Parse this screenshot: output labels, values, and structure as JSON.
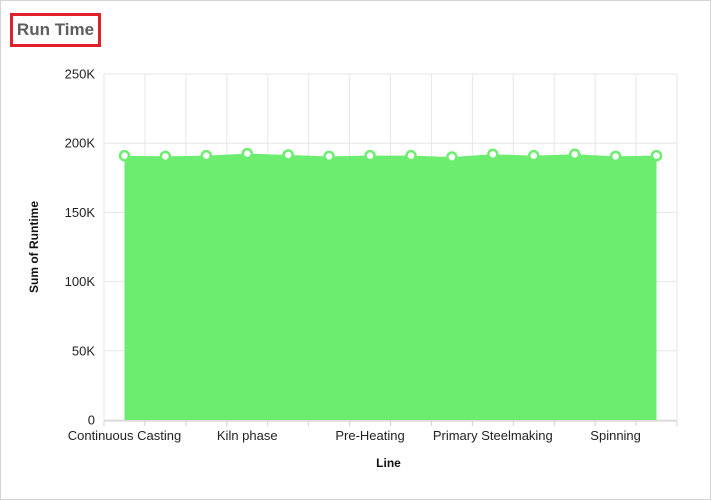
{
  "card": {
    "title": "Run Time"
  },
  "chart_data": {
    "type": "area",
    "title": "Run Time",
    "xlabel": "Line",
    "ylabel": "Sum of Runtime",
    "ylim": [
      0,
      250000
    ],
    "yticks": [
      {
        "value": 0,
        "label": "0"
      },
      {
        "value": 50000,
        "label": "50K"
      },
      {
        "value": 100000,
        "label": "100K"
      },
      {
        "value": 150000,
        "label": "150K"
      },
      {
        "value": 200000,
        "label": "200K"
      },
      {
        "value": 250000,
        "label": "250K"
      }
    ],
    "x_tick_labels": [
      {
        "index": 0,
        "label": "Continuous Casting"
      },
      {
        "index": 3,
        "label": "Kiln phase"
      },
      {
        "index": 6,
        "label": "Pre-Heating"
      },
      {
        "index": 9,
        "label": "Primary Steelmaking"
      },
      {
        "index": 12,
        "label": "Spinning"
      }
    ],
    "values": [
      191000,
      190500,
      191000,
      192500,
      191500,
      190500,
      191000,
      191000,
      190000,
      192000,
      191000,
      192000,
      190500,
      191000
    ],
    "grid": true,
    "fill_color": "#6ded70",
    "marker_color": "#6ded70"
  }
}
